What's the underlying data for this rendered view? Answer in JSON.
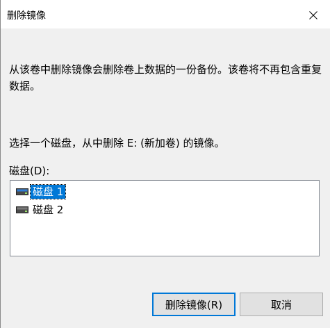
{
  "dialog": {
    "title": "删除镜像",
    "description": "从该卷中删除镜像会删除卷上数据的一份备份。该卷将不再包含重复数据。",
    "prompt": "选择一个磁盘，从中删除 E: (新加卷) 的镜像。",
    "disk_label": "磁盘(D):",
    "disks": [
      {
        "label": "磁盘 1",
        "selected": true
      },
      {
        "label": "磁盘 2",
        "selected": false
      }
    ],
    "buttons": {
      "remove_label": "删除镜像(R)",
      "cancel_label": "取消"
    }
  },
  "icons": {
    "close": "close-icon",
    "disk": "disk-drive-icon"
  },
  "colors": {
    "selection": "#0078d7",
    "disk_icon_accent": "#2e7dd6"
  }
}
